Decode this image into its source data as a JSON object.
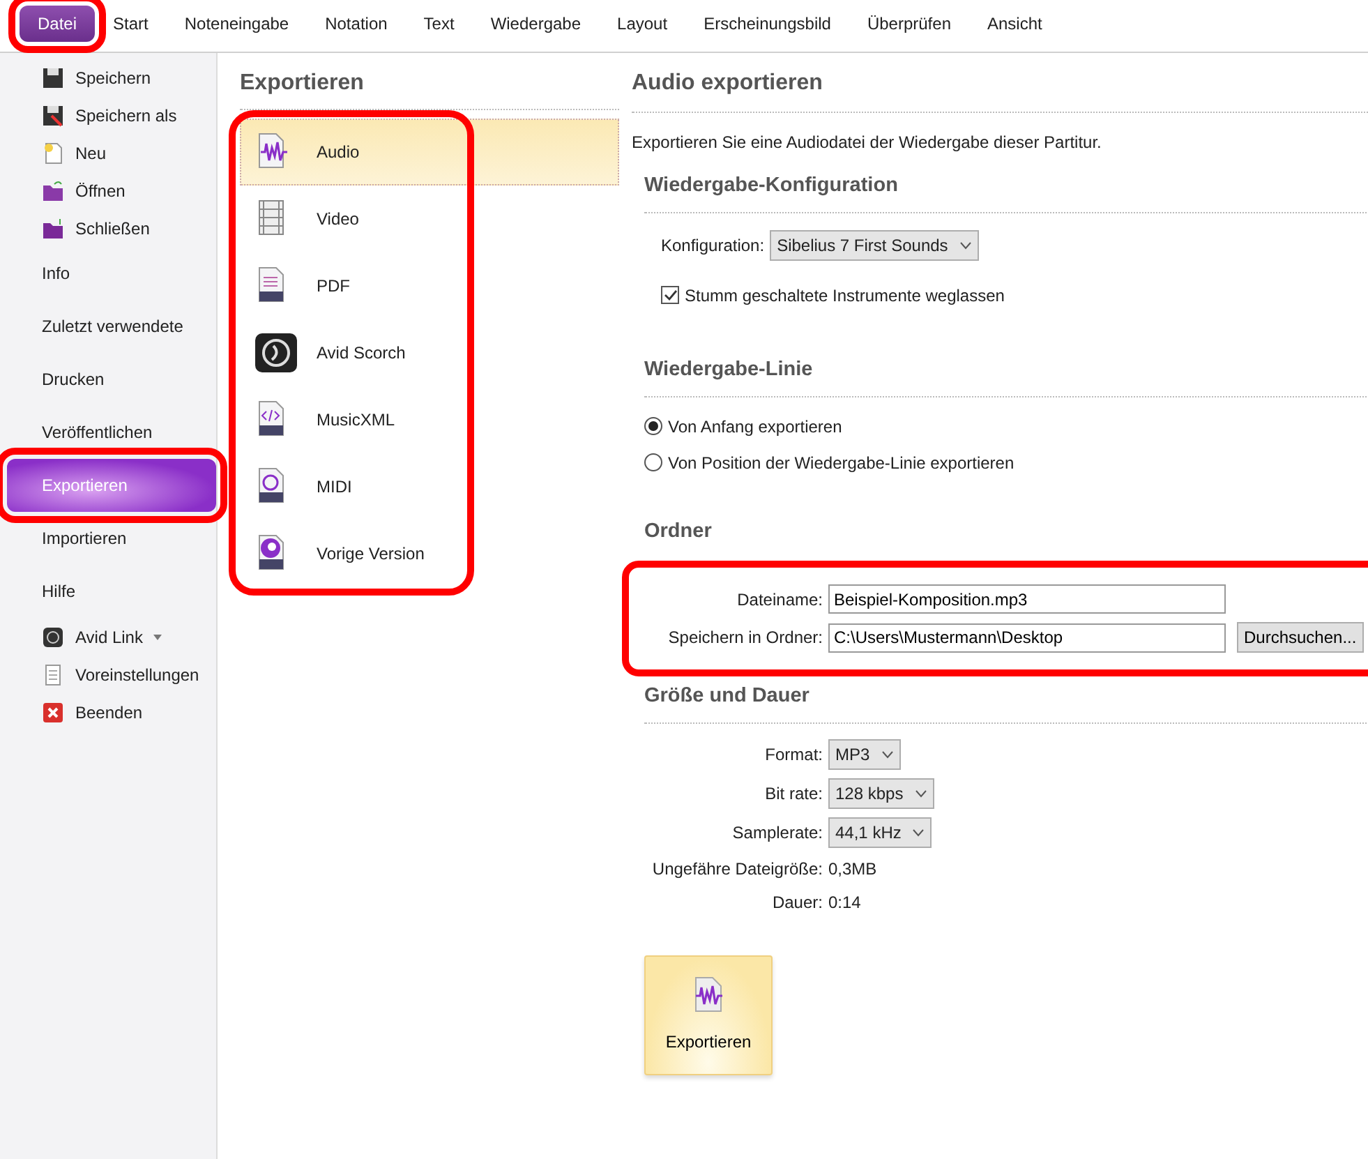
{
  "ribbon_tabs": [
    {
      "label": "Datei",
      "selected": true,
      "highlighted": true
    },
    {
      "label": "Start",
      "selected": false,
      "highlighted": false
    },
    {
      "label": "Noteneingabe",
      "selected": false,
      "highlighted": false
    },
    {
      "label": "Notation",
      "selected": false,
      "highlighted": false
    },
    {
      "label": "Text",
      "selected": false,
      "highlighted": false
    },
    {
      "label": "Wiedergabe",
      "selected": false,
      "highlighted": false
    },
    {
      "label": "Layout",
      "selected": false,
      "highlighted": false
    },
    {
      "label": "Erscheinungsbild",
      "selected": false,
      "highlighted": false
    },
    {
      "label": "Überprüfen",
      "selected": false,
      "highlighted": false
    },
    {
      "label": "Ansicht",
      "selected": false,
      "highlighted": false
    }
  ],
  "sidebar": {
    "items": [
      {
        "kind": "icon",
        "label": "Speichern",
        "selected": false,
        "highlighted": false
      },
      {
        "kind": "icon",
        "label": "Speichern als",
        "selected": false,
        "highlighted": false
      },
      {
        "kind": "icon",
        "label": "Neu",
        "selected": false,
        "highlighted": false
      },
      {
        "kind": "icon",
        "label": "Öffnen",
        "selected": false,
        "highlighted": false
      },
      {
        "kind": "icon",
        "label": "Schließen",
        "selected": false,
        "highlighted": false
      },
      {
        "kind": "text",
        "label": "Info",
        "selected": false,
        "highlighted": false
      },
      {
        "kind": "text",
        "label": "Zuletzt verwendete",
        "selected": false,
        "highlighted": false
      },
      {
        "kind": "text",
        "label": "Drucken",
        "selected": false,
        "highlighted": false
      },
      {
        "kind": "text",
        "label": "Veröffentlichen",
        "selected": false,
        "highlighted": false
      },
      {
        "kind": "text",
        "label": "Exportieren",
        "selected": true,
        "highlighted": true
      },
      {
        "kind": "text",
        "label": "Importieren",
        "selected": false,
        "highlighted": false
      },
      {
        "kind": "text",
        "label": "Hilfe",
        "selected": false,
        "highlighted": false
      },
      {
        "kind": "dropdown",
        "label": "Avid Link",
        "selected": false,
        "highlighted": false
      },
      {
        "kind": "icon",
        "label": "Voreinstellungen",
        "selected": false,
        "highlighted": false
      },
      {
        "kind": "icon",
        "label": "Beenden",
        "selected": false,
        "highlighted": false
      }
    ]
  },
  "export_list": {
    "title": "Exportieren",
    "highlighted": true,
    "items": [
      {
        "label": "Audio",
        "selected": true
      },
      {
        "label": "Video",
        "selected": false
      },
      {
        "label": "PDF",
        "selected": false
      },
      {
        "label": "Avid Scorch",
        "selected": false
      },
      {
        "label": "MusicXML",
        "selected": false
      },
      {
        "label": "MIDI",
        "selected": false
      },
      {
        "label": "Vorige Version",
        "selected": false
      }
    ]
  },
  "panel": {
    "title": "Audio exportieren",
    "description": "Exportieren Sie eine Audiodatei der Wiedergabe dieser Partitur.",
    "sections": [
      {
        "title": "Wiedergabe-Konfiguration",
        "highlighted": false,
        "rows": [
          {
            "kind": "select",
            "label": "Konfiguration:",
            "value": "Sibelius 7 First Sounds"
          },
          {
            "kind": "checkbox",
            "label": "Stumm geschaltete Instrumente weglassen",
            "checked": true
          }
        ]
      },
      {
        "title": "Wiedergabe-Linie",
        "highlighted": false,
        "rows": [
          {
            "kind": "radio",
            "label": "Von Anfang exportieren",
            "selected": true
          },
          {
            "kind": "radio",
            "label": "Von Position der Wiedergabe-Linie exportieren",
            "selected": false
          }
        ]
      },
      {
        "title": "Ordner",
        "highlighted": true,
        "rows": [
          {
            "kind": "text_field",
            "label": "Dateiname:",
            "value": "Beispiel-Komposition.mp3"
          },
          {
            "kind": "text_field",
            "label": "Speichern in Ordner:",
            "value": "C:\\Users\\Mustermann\\Desktop",
            "button": "Durchsuchen..."
          }
        ]
      },
      {
        "title": "Größe und Dauer",
        "highlighted": false,
        "rows": [
          {
            "kind": "form_select",
            "label": "Format:",
            "value": "MP3"
          },
          {
            "kind": "form_select",
            "label": "Bit rate:",
            "value": "128 kbps"
          },
          {
            "kind": "form_select",
            "label": "Samplerate:",
            "value": "44,1 kHz"
          },
          {
            "kind": "info",
            "label": "Ungefähre Dateigröße:",
            "value": "0,3MB"
          },
          {
            "kind": "info",
            "label": "Dauer:",
            "value": "0:14"
          }
        ]
      }
    ],
    "export_button": {
      "label": "Exportieren"
    }
  }
}
